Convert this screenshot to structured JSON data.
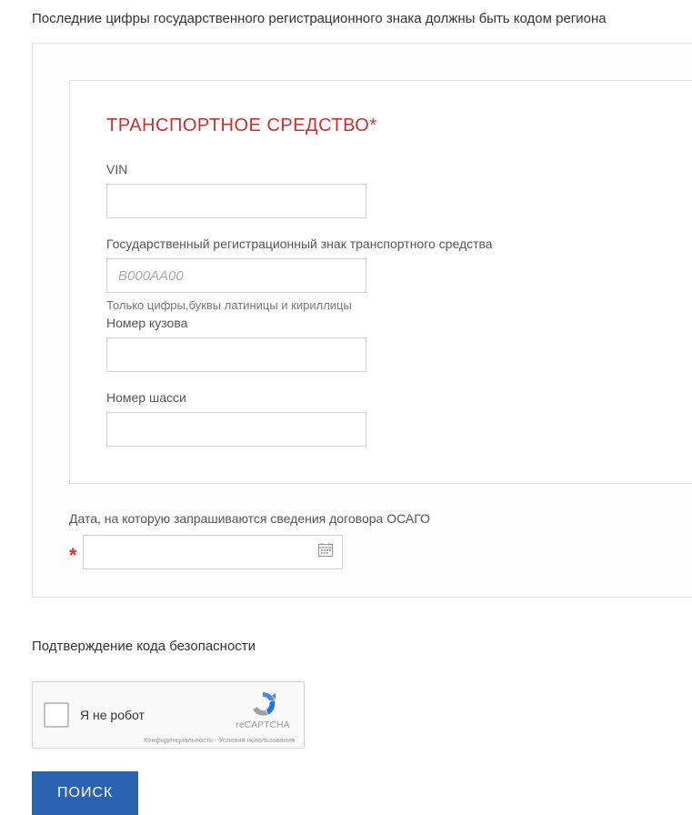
{
  "instruction": "Последние цифры государственного регистрационного знака должны быть кодом региона",
  "panel": {
    "title": "ТРАНСПОРТНОЕ СРЕДСТВО*",
    "vin": {
      "label": "VIN",
      "value": ""
    },
    "plate": {
      "label": "Государственный регистрационный знак транспортного средства",
      "placeholder": "B000AA00",
      "helper": "Только цифры,буквы латиницы и кириллицы"
    },
    "body": {
      "label": "Номер кузова",
      "value": ""
    },
    "chassis": {
      "label": "Номер шасси",
      "value": ""
    }
  },
  "date": {
    "label": "Дата, на которую запрашиваются сведения договора ОСАГО",
    "value": ""
  },
  "security": {
    "label": "Подтверждение кода безопасности",
    "recaptcha_text": "Я не робот",
    "recaptcha_brand": "reCAPTCHA",
    "recaptcha_links": "Конфиденциальность - Условия использования"
  },
  "search_button": "ПОИСК"
}
